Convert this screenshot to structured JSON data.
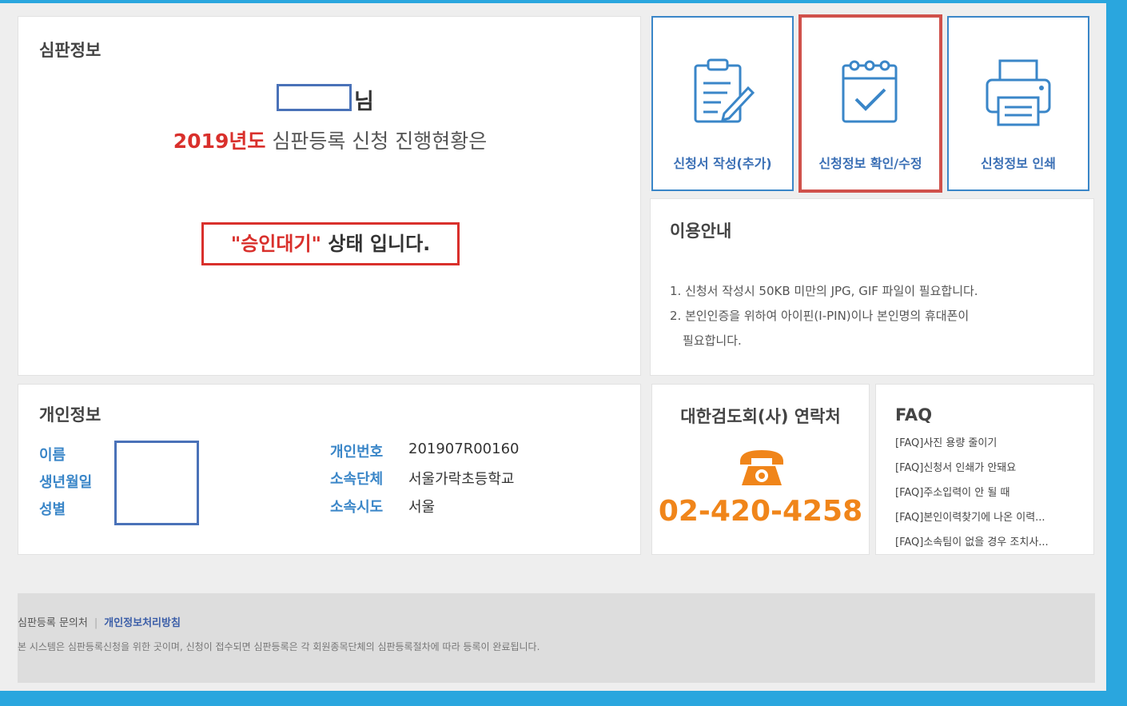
{
  "judgment": {
    "title": "심판정보",
    "name_suffix": "님",
    "year": "2019년도",
    "status_intro": " 심판등록 신청 진행현황은",
    "status_value": "\"승인대기\"",
    "status_suffix": " 상태 입니다."
  },
  "tiles": [
    {
      "label": "신청서 작성(추가)",
      "icon": "clipboard-edit-icon"
    },
    {
      "label": "신청정보 확인/수정",
      "icon": "calendar-check-icon"
    },
    {
      "label": "신청정보 인쇄",
      "icon": "printer-icon"
    }
  ],
  "guide": {
    "title": "이용안내",
    "items": [
      "1. 신청서 작성시 50KB 미만의 JPG, GIF 파일이 필요합니다.",
      "2. 본인인증을 위하여 아이핀(I-PIN)이나 본인명의 휴대폰이",
      "필요합니다."
    ]
  },
  "personal": {
    "title": "개인정보",
    "left_labels": [
      "이름",
      "생년월일",
      "성별"
    ],
    "right_labels": [
      "개인번호",
      "소속단체",
      "소속시도"
    ],
    "right_values": [
      "201907R00160",
      "서울가락초등학교",
      "서울"
    ]
  },
  "contact": {
    "title": "대한검도회(사) 연락처",
    "phone": "02-420-4258",
    "icon": "phone-icon"
  },
  "faq": {
    "title": "FAQ",
    "items": [
      "[FAQ]사진 용량 줄이기",
      "[FAQ]신청서 인쇄가 안돼요",
      "[FAQ]주소입력이 안 될 때",
      "[FAQ]본인이력찾기에 나온 이력...",
      "[FAQ]소속팀이 없을 경우 조치사..."
    ]
  },
  "footer": {
    "inquiry": "심판등록 문의처",
    "separator": "|",
    "policy": "개인정보처리방침",
    "note": "본 시스템은 심판등록신청을 위한 곳이며, 신청이 접수되면 심판등록은 각 회원종목단체의 심판등록절차에 따라 등록이 완료됩니다."
  },
  "colors": {
    "background": "#2aa6de",
    "accent_blue": "#3a86c8",
    "highlight_red": "#d9302c",
    "phone_orange": "#f0851a"
  }
}
